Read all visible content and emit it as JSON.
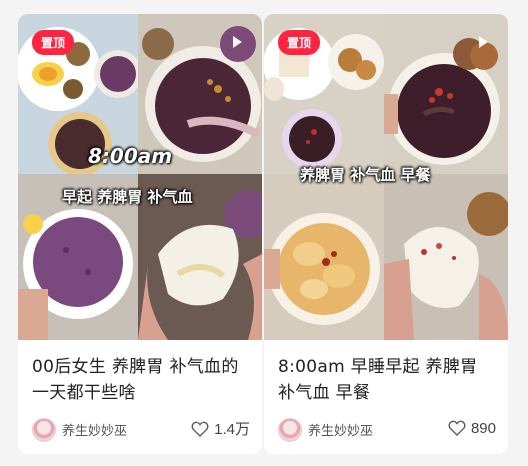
{
  "feed": {
    "cards": [
      {
        "pin_badge": "置顶",
        "cover_overlay_time": "8:00am",
        "cover_overlay_caption": "早起 养脾胃 补气血",
        "title": "00后女生 养脾胃 补气血的一天都干些啥",
        "author": "养生妙妙巫",
        "likes": "1.4万",
        "icons": [
          "play-icon",
          "heart-icon"
        ]
      },
      {
        "pin_badge": "置顶",
        "cover_overlay_caption": "养脾胃 补气血 早餐",
        "title": "8:00am 早睡早起 养脾胃 补气血 早餐",
        "author": "养生妙妙巫",
        "likes": "890",
        "icons": [
          "play-icon",
          "heart-icon"
        ]
      }
    ]
  },
  "colors": {
    "pin_badge": "#ff2442",
    "purple_porridge": "#4a2636",
    "taro_purple": "#7a4a7e",
    "page_background": "#f4f4f4"
  }
}
